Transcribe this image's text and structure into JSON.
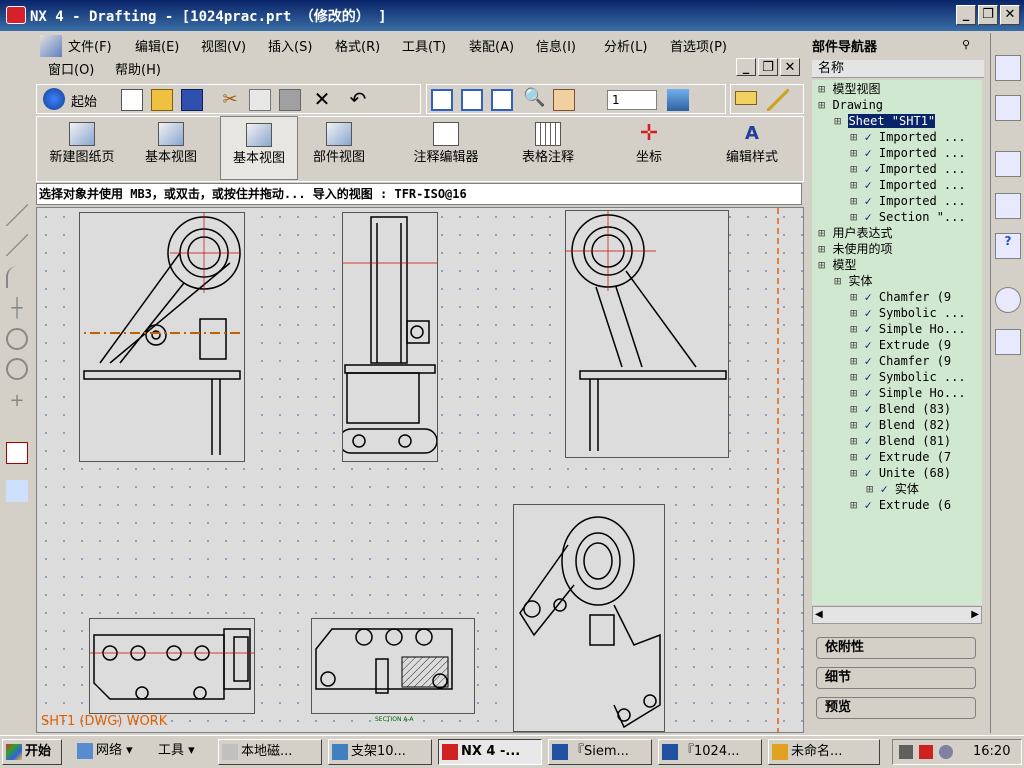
{
  "window": {
    "title": "NX 4 - Drafting - [1024prac.prt （修改的） ]"
  },
  "menu": {
    "row1": [
      "文件(F)",
      "编辑(E)",
      "视图(V)",
      "插入(S)",
      "格式(R)",
      "工具(T)",
      "装配(A)",
      "信息(I)",
      "分析(L)",
      "首选项(P)"
    ],
    "row2": [
      "窗口(O)",
      "帮助(H)"
    ]
  },
  "toolbar": {
    "start_label": "起始",
    "layer_value": "1"
  },
  "ribbon": {
    "new_sheet": "新建图纸页",
    "base_view1": "基本视图",
    "base_view2": "基本视图",
    "part_view": "部件视图",
    "annotation_editor": "注释编辑器",
    "table_note": "表格注释",
    "coordinate": "坐标",
    "edit_style": "编辑样式"
  },
  "status": {
    "text": "选择对象并使用 MB3，或双击，或按住并拖动... 导入的视图 : TFR-ISO@16"
  },
  "canvas": {
    "sheet_label": "SHT1 (DWG) WORK",
    "section_label": "SECTION A-A"
  },
  "nav": {
    "title": "部件导航器",
    "column": "名称",
    "tree": [
      {
        "label": "模型视图",
        "indent": 0
      },
      {
        "label": "Drawing",
        "indent": 0
      },
      {
        "label": "Sheet \"SHT1\"",
        "indent": 1
      },
      {
        "label": "Imported ...",
        "indent": 2
      },
      {
        "label": "Imported ...",
        "indent": 2
      },
      {
        "label": "Imported ...",
        "indent": 2
      },
      {
        "label": "Imported ...",
        "indent": 2
      },
      {
        "label": "Imported ...",
        "indent": 2
      },
      {
        "label": "Section \"...",
        "indent": 2
      },
      {
        "label": "用户表达式",
        "indent": 0
      },
      {
        "label": "未使用的项",
        "indent": 0
      },
      {
        "label": "模型",
        "indent": 0
      },
      {
        "label": "实体",
        "indent": 1
      },
      {
        "label": "Chamfer (9",
        "indent": 2
      },
      {
        "label": "Symbolic ...",
        "indent": 2
      },
      {
        "label": "Simple Ho...",
        "indent": 2
      },
      {
        "label": "Extrude (9",
        "indent": 2
      },
      {
        "label": "Chamfer (9",
        "indent": 2
      },
      {
        "label": "Symbolic ...",
        "indent": 2
      },
      {
        "label": "Simple Ho...",
        "indent": 2
      },
      {
        "label": "Blend (83)",
        "indent": 2
      },
      {
        "label": "Blend (82)",
        "indent": 2
      },
      {
        "label": "Blend (81)",
        "indent": 2
      },
      {
        "label": "Extrude (7",
        "indent": 2
      },
      {
        "label": "Unite (68)",
        "indent": 2
      },
      {
        "label": "实体",
        "indent": 3
      },
      {
        "label": "Extrude (6",
        "indent": 2
      }
    ],
    "panels": [
      "依附性",
      "细节",
      "预览"
    ]
  },
  "taskbar": {
    "start": "开始",
    "network": "网络",
    "tools": "工具",
    "tasks": [
      "本地磁...",
      "支架10...",
      "NX 4 -...",
      "『Siem...",
      "『1024...",
      "未命名..."
    ],
    "clock": "16:20"
  }
}
